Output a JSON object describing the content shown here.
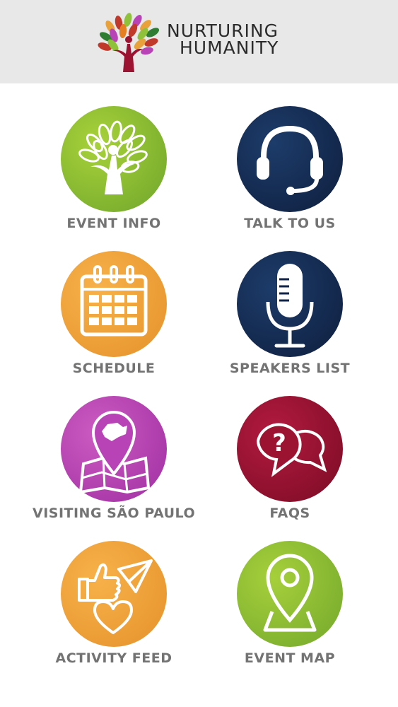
{
  "header": {
    "brand_line1": "NURTURING",
    "brand_line2": "HUMANITY",
    "background": "#e8e8e8"
  },
  "tiles": [
    {
      "label": "EVENT INFO",
      "icon": "tree-icon",
      "color": "#8fc13a"
    },
    {
      "label": "TALK TO US",
      "icon": "headset-icon",
      "color": "#0f2448"
    },
    {
      "label": "SCHEDULE",
      "icon": "calendar-icon",
      "color": "#f1a23b"
    },
    {
      "label": "SPEAKERS LIST",
      "icon": "microphone-icon",
      "color": "#0f2448"
    },
    {
      "label": "VISITING SÃO PAULO",
      "icon": "map-pin-icon",
      "color": "#b843b6"
    },
    {
      "label": "FAQS",
      "icon": "chat-question-icon",
      "color": "#9c1231"
    },
    {
      "label": "ACTIVITY FEED",
      "icon": "like-send-heart-icon",
      "color": "#f1a23b"
    },
    {
      "label": "EVENT MAP",
      "icon": "location-pin-icon",
      "color": "#8fc13a"
    }
  ],
  "label_color": "#737373"
}
